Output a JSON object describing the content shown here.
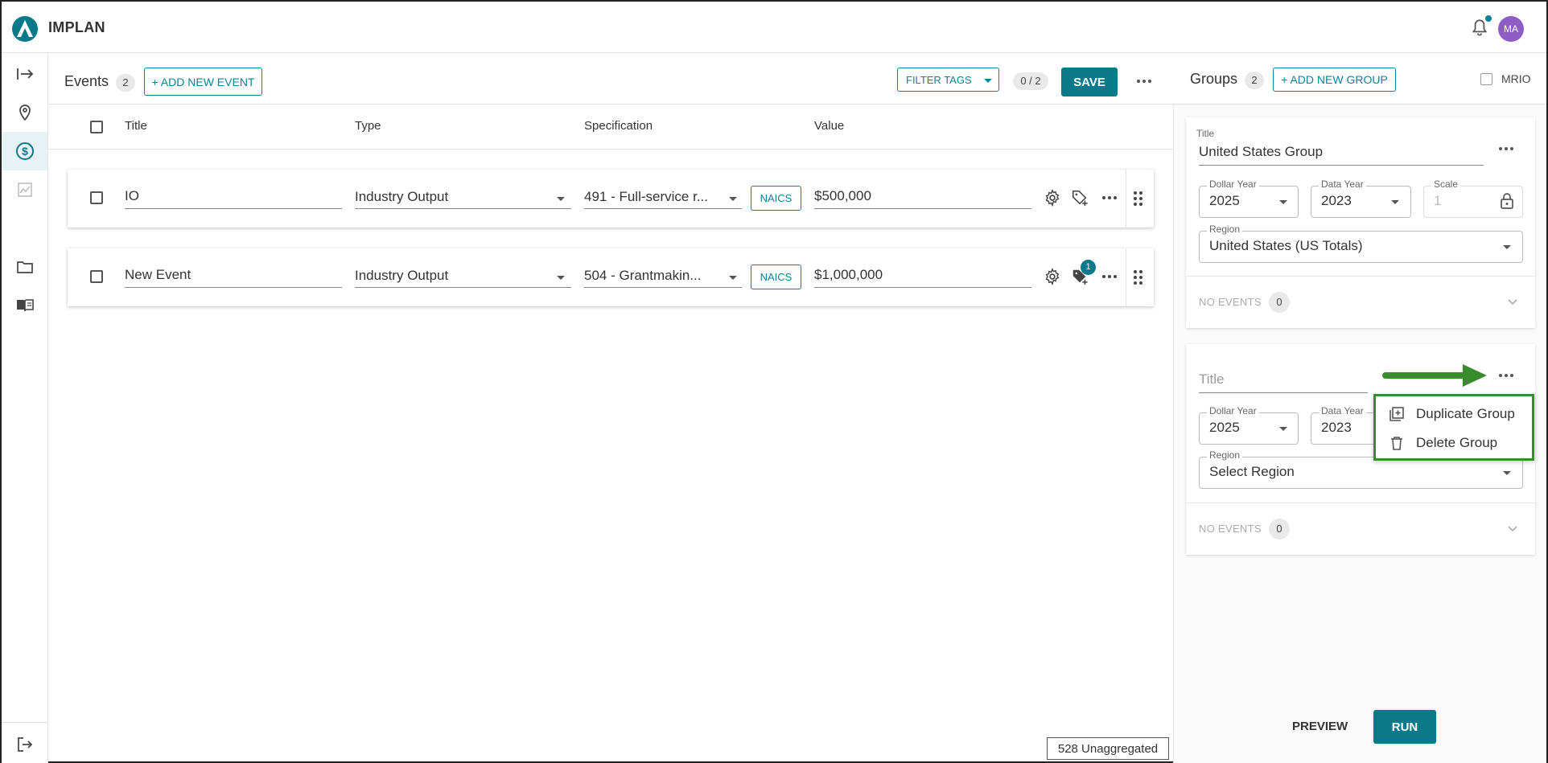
{
  "app": {
    "brand": "IMPLAN",
    "avatar_initials": "MA",
    "notification_dot": true,
    "accent_color": "#0a8496",
    "avatar_color": "#8e5cc5"
  },
  "rail": {
    "items": [
      {
        "icon": "expand-arrow-icon"
      },
      {
        "icon": "map-pin-icon"
      },
      {
        "icon": "dollar-circle-icon",
        "active": true
      },
      {
        "icon": "chart-icon"
      },
      {
        "icon": "folder-icon"
      },
      {
        "icon": "book-icon"
      },
      {
        "icon": "logout-icon"
      }
    ]
  },
  "events": {
    "title": "Events",
    "count": "2",
    "add_label": "+ ADD NEW EVENT",
    "filter_label": "FILTER TAGS",
    "selection": "0 / 2",
    "save_label": "SAVE",
    "columns": {
      "title": "Title",
      "type": "Type",
      "specification": "Specification",
      "value": "Value"
    },
    "rows": [
      {
        "title": "IO",
        "type": "Industry Output",
        "specification": "491 - Full-service r...",
        "naics": "NAICS",
        "value": "$500,000",
        "tag_badge": ""
      },
      {
        "title": "New Event",
        "type": "Industry Output",
        "specification": "504 - Grantmakin...",
        "naics": "NAICS",
        "value": "$1,000,000",
        "tag_badge": "1"
      }
    ],
    "unaggregated": "528 Unaggregated"
  },
  "groups": {
    "title": "Groups",
    "count": "2",
    "add_label": "+ ADD NEW GROUP",
    "mrio_label": "MRIO",
    "cards": [
      {
        "title_label": "Title",
        "title_value": "United States Group",
        "dollar_year_label": "Dollar Year",
        "dollar_year": "2025",
        "data_year_label": "Data Year",
        "data_year": "2023",
        "scale_label": "Scale",
        "scale": "1",
        "region_label": "Region",
        "region": "United States (US Totals)",
        "no_events_label": "NO EVENTS",
        "no_events_count": "0"
      },
      {
        "title_placeholder": "Title",
        "dollar_year_label": "Dollar Year",
        "dollar_year": "2025",
        "data_year_label": "Data Year",
        "data_year": "2023",
        "region_label": "Region",
        "region": "Select Region",
        "no_events_label": "NO EVENTS",
        "no_events_count": "0"
      }
    ],
    "menu": {
      "duplicate": "Duplicate Group",
      "delete": "Delete Group"
    },
    "preview_label": "PREVIEW",
    "run_label": "RUN"
  }
}
